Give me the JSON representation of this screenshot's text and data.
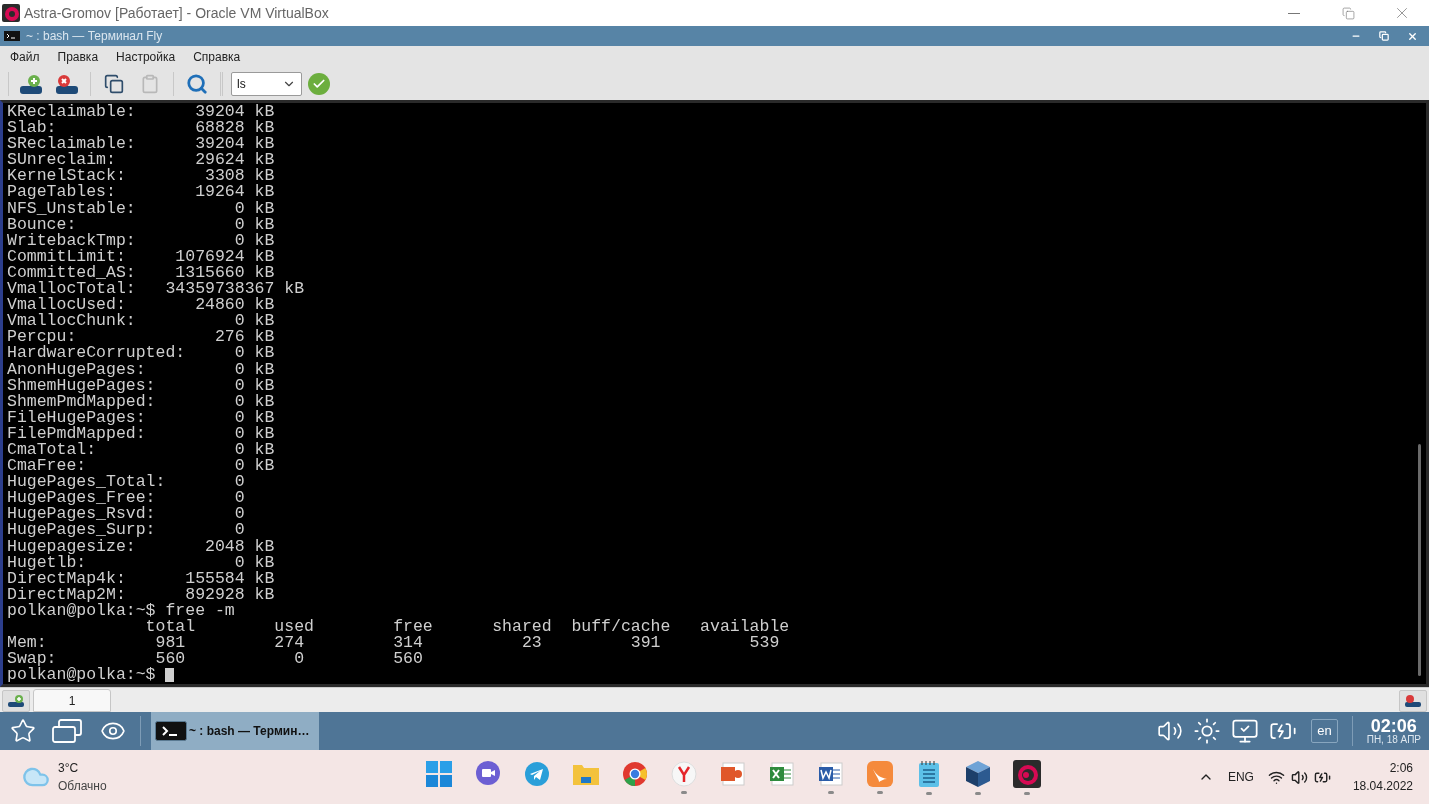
{
  "window": {
    "title": "Astra-Gromov [Работает] - Oracle VM VirtualBox"
  },
  "terminal_window": {
    "title": "~ : bash — Терминал Fly"
  },
  "menu": [
    "Файл",
    "Правка",
    "Настройка",
    "Справка"
  ],
  "toolbar": {
    "buttons": [
      {
        "kind": "add",
        "disabled": false
      },
      {
        "kind": "remove",
        "disabled": false
      },
      {
        "kind": "copy",
        "disabled": false
      },
      {
        "kind": "paste",
        "disabled": true
      },
      {
        "kind": "search",
        "disabled": false
      }
    ],
    "command": "ls"
  },
  "terminal": {
    "lines": [
      "KReclaimable:      39204 kB",
      "Slab:              68828 kB",
      "SReclaimable:      39204 kB",
      "SUnreclaim:        29624 kB",
      "KernelStack:        3308 kB",
      "PageTables:        19264 kB",
      "NFS_Unstable:          0 kB",
      "Bounce:                0 kB",
      "WritebackTmp:          0 kB",
      "CommitLimit:     1076924 kB",
      "Committed_AS:    1315660 kB",
      "VmallocTotal:   34359738367 kB",
      "VmallocUsed:       24860 kB",
      "VmallocChunk:          0 kB",
      "Percpu:              276 kB",
      "HardwareCorrupted:     0 kB",
      "AnonHugePages:         0 kB",
      "ShmemHugePages:        0 kB",
      "ShmemPmdMapped:        0 kB",
      "FileHugePages:         0 kB",
      "FilePmdMapped:         0 kB",
      "CmaTotal:              0 kB",
      "CmaFree:               0 kB",
      "HugePages_Total:       0",
      "HugePages_Free:        0",
      "HugePages_Rsvd:        0",
      "HugePages_Surp:        0",
      "Hugepagesize:       2048 kB",
      "Hugetlb:               0 kB",
      "DirectMap4k:      155584 kB",
      "DirectMap2M:      892928 kB",
      "polkan@polka:~$ free -m",
      "              total        used        free      shared  buff/cache   available",
      "Mem:           981         274         314          23         391         539",
      "Swap:          560           0         560"
    ],
    "prompt": "polkan@polka:~$ "
  },
  "terminal_tabs": [
    {
      "label": "1",
      "selected": true
    }
  ],
  "fly_taskbar": {
    "task": "~ : bash — Термин…",
    "language": "en",
    "time": "02:06",
    "date": "ПН, 18 АПР"
  },
  "windows_taskbar": {
    "weather": {
      "temperature": "3°C",
      "condition": "Облачно"
    },
    "apps": [
      {
        "kind": "windows",
        "running": false
      },
      {
        "kind": "chat",
        "running": false
      },
      {
        "kind": "plane",
        "running": false
      },
      {
        "kind": "folder",
        "running": false
      },
      {
        "kind": "browser",
        "running": false
      },
      {
        "kind": "red-circle",
        "running": true
      },
      {
        "kind": "slides",
        "running": false
      },
      {
        "kind": "sheet",
        "running": false
      },
      {
        "kind": "doc",
        "running": true
      },
      {
        "kind": "orange",
        "running": true
      },
      {
        "kind": "notes",
        "running": true
      },
      {
        "kind": "cube",
        "running": true
      },
      {
        "kind": "swirl",
        "running": true
      }
    ],
    "language": "ENG",
    "time": "2:06",
    "date": "18.04.2022"
  }
}
